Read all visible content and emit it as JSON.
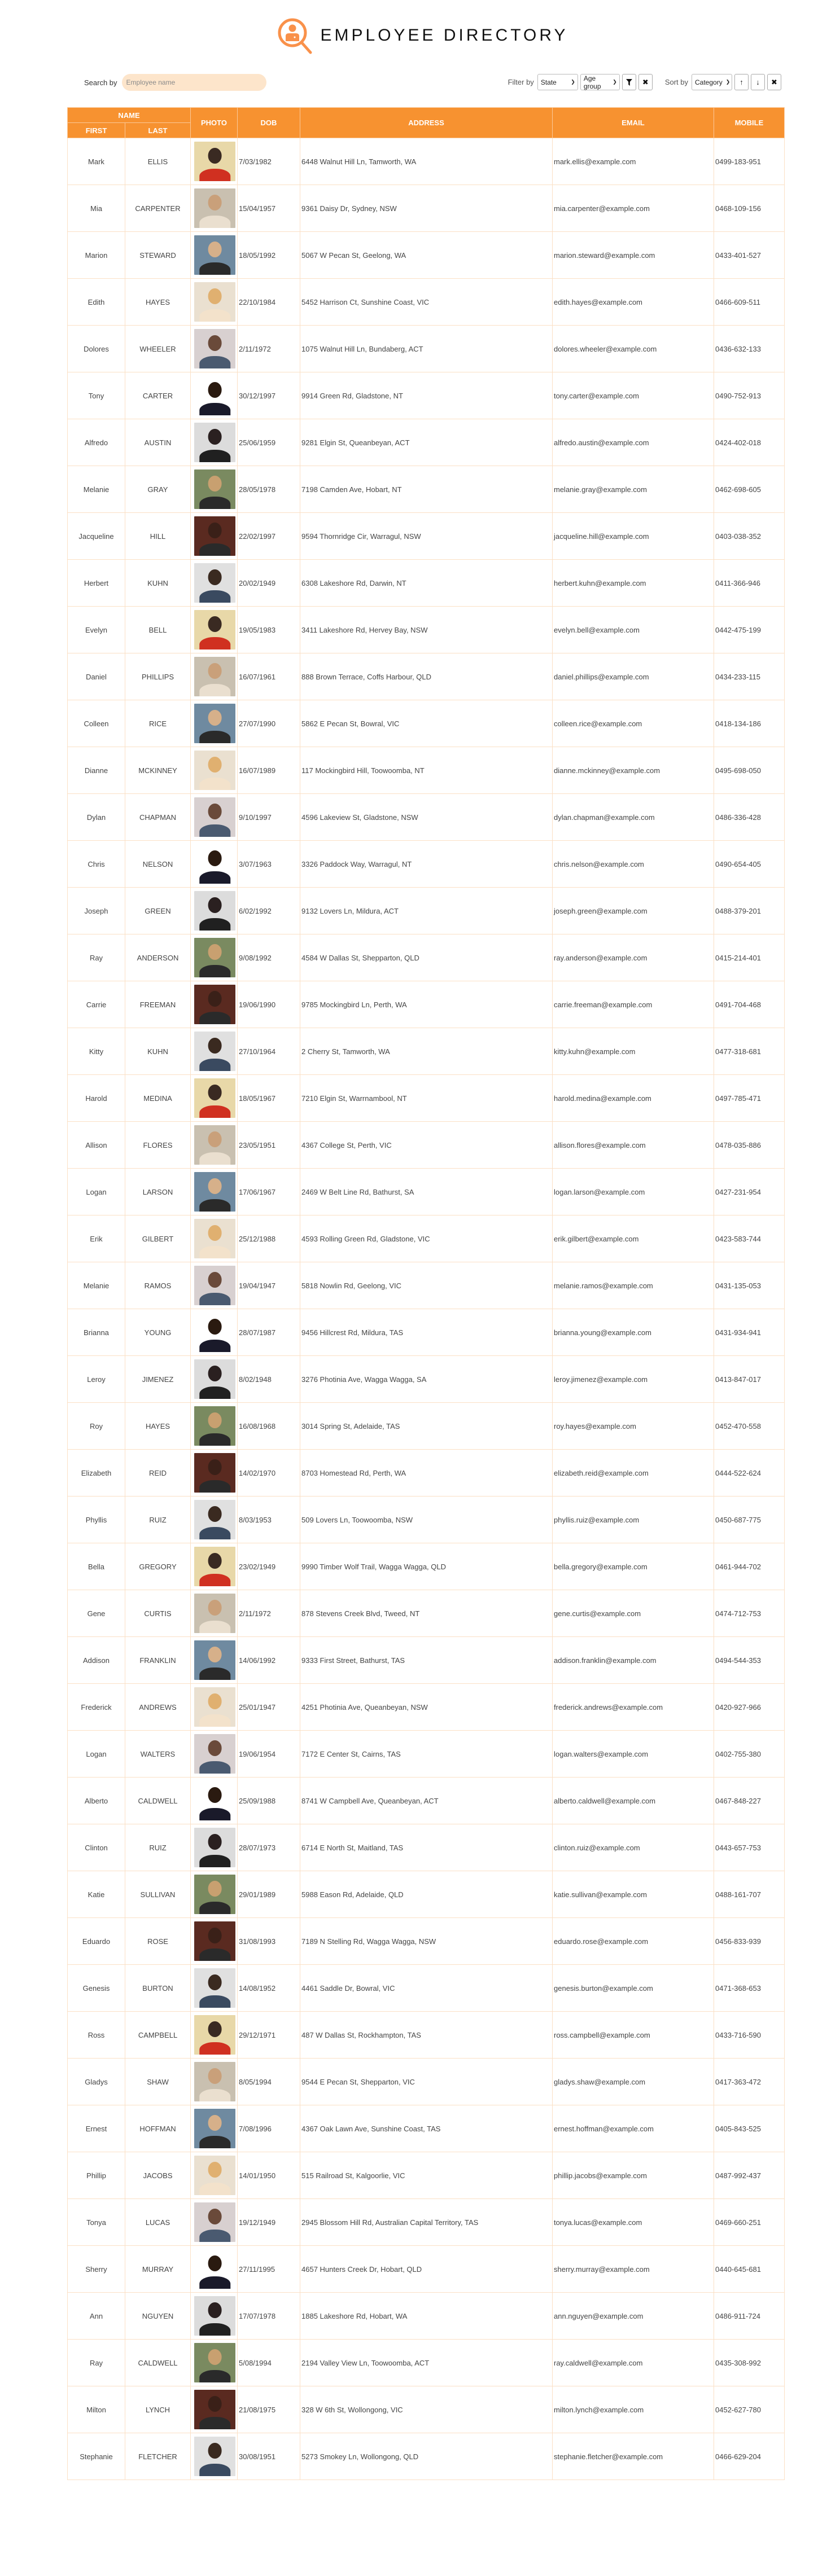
{
  "app": {
    "title": "EMPLOYEE DIRECTORY",
    "logo_icon": "magnifier-employee-icon",
    "accent_color": "#f79230",
    "accent_light": "#fde5cb"
  },
  "search": {
    "label": "Search by",
    "placeholder": "Employee name",
    "value": ""
  },
  "filter": {
    "label": "Filter by",
    "state_selected": "State",
    "age_selected": "Age group",
    "apply_icon": "funnel-icon",
    "clear_icon": "close-icon"
  },
  "sort": {
    "label": "Sort by",
    "category_selected": "Category",
    "asc_icon": "arrow-up-icon",
    "desc_icon": "arrow-down-icon",
    "clear_icon": "close-icon"
  },
  "table": {
    "headers": {
      "name": "NAME",
      "first": "FIRST",
      "last": "LAST",
      "photo": "PHOTO",
      "dob": "DOB",
      "address": "ADDRESS",
      "email": "EMAIL",
      "mobile": "MOBILE"
    },
    "rows": [
      {
        "first": "Mark",
        "last": "ELLIS",
        "dob": "7/03/1982",
        "address": "6448 Walnut Hill Ln, Tamworth, WA",
        "email": "mark.ellis@example.com",
        "mobile": "0499-183-951"
      },
      {
        "first": "Mia",
        "last": "CARPENTER",
        "dob": "15/04/1957",
        "address": "9361 Daisy Dr, Sydney, NSW",
        "email": "mia.carpenter@example.com",
        "mobile": "0468-109-156"
      },
      {
        "first": "Marion",
        "last": "STEWARD",
        "dob": "18/05/1992",
        "address": "5067 W Pecan St, Geelong, WA",
        "email": "marion.steward@example.com",
        "mobile": "0433-401-527"
      },
      {
        "first": "Edith",
        "last": "HAYES",
        "dob": "22/10/1984",
        "address": "5452 Harrison Ct, Sunshine Coast, VIC",
        "email": "edith.hayes@example.com",
        "mobile": "0466-609-511"
      },
      {
        "first": "Dolores",
        "last": "WHEELER",
        "dob": "2/11/1972",
        "address": "1075 Walnut Hill Ln, Bundaberg, ACT",
        "email": "dolores.wheeler@example.com",
        "mobile": "0436-632-133"
      },
      {
        "first": "Tony",
        "last": "CARTER",
        "dob": "30/12/1997",
        "address": "9914 Green Rd, Gladstone, NT",
        "email": "tony.carter@example.com",
        "mobile": "0490-752-913"
      },
      {
        "first": "Alfredo",
        "last": "AUSTIN",
        "dob": "25/06/1959",
        "address": "9281 Elgin St, Queanbeyan, ACT",
        "email": "alfredo.austin@example.com",
        "mobile": "0424-402-018"
      },
      {
        "first": "Melanie",
        "last": "GRAY",
        "dob": "28/05/1978",
        "address": "7198 Camden Ave, Hobart, NT",
        "email": "melanie.gray@example.com",
        "mobile": "0462-698-605"
      },
      {
        "first": "Jacqueline",
        "last": "HILL",
        "dob": "22/02/1997",
        "address": "9594 Thornridge Cir, Warragul, NSW",
        "email": "jacqueline.hill@example.com",
        "mobile": "0403-038-352"
      },
      {
        "first": "Herbert",
        "last": "KUHN",
        "dob": "20/02/1949",
        "address": "6308 Lakeshore Rd, Darwin, NT",
        "email": "herbert.kuhn@example.com",
        "mobile": "0411-366-946"
      },
      {
        "first": "Evelyn",
        "last": "BELL",
        "dob": "19/05/1983",
        "address": "3411 Lakeshore Rd, Hervey Bay, NSW",
        "email": "evelyn.bell@example.com",
        "mobile": "0442-475-199"
      },
      {
        "first": "Daniel",
        "last": "PHILLIPS",
        "dob": "16/07/1961",
        "address": "888 Brown Terrace, Coffs Harbour, QLD",
        "email": "daniel.phillips@example.com",
        "mobile": "0434-233-115"
      },
      {
        "first": "Colleen",
        "last": "RICE",
        "dob": "27/07/1990",
        "address": "5862 E Pecan St, Bowral, VIC",
        "email": "colleen.rice@example.com",
        "mobile": "0418-134-186"
      },
      {
        "first": "Dianne",
        "last": "MCKINNEY",
        "dob": "16/07/1989",
        "address": "117 Mockingbird Hill, Toowoomba, NT",
        "email": "dianne.mckinney@example.com",
        "mobile": "0495-698-050"
      },
      {
        "first": "Dylan",
        "last": "CHAPMAN",
        "dob": "9/10/1997",
        "address": "4596 Lakeview St, Gladstone, NSW",
        "email": "dylan.chapman@example.com",
        "mobile": "0486-336-428"
      },
      {
        "first": "Chris",
        "last": "NELSON",
        "dob": "3/07/1963",
        "address": "3326 Paddock Way, Warragul, NT",
        "email": "chris.nelson@example.com",
        "mobile": "0490-654-405"
      },
      {
        "first": "Joseph",
        "last": "GREEN",
        "dob": "6/02/1992",
        "address": "9132 Lovers Ln, Mildura, ACT",
        "email": "joseph.green@example.com",
        "mobile": "0488-379-201"
      },
      {
        "first": "Ray",
        "last": "ANDERSON",
        "dob": "9/08/1992",
        "address": "4584 W Dallas St, Shepparton, QLD",
        "email": "ray.anderson@example.com",
        "mobile": "0415-214-401"
      },
      {
        "first": "Carrie",
        "last": "FREEMAN",
        "dob": "19/06/1990",
        "address": "9785 Mockingbird Ln, Perth, WA",
        "email": "carrie.freeman@example.com",
        "mobile": "0491-704-468"
      },
      {
        "first": "Kitty",
        "last": "KUHN",
        "dob": "27/10/1964",
        "address": "2 Cherry St, Tamworth, WA",
        "email": "kitty.kuhn@example.com",
        "mobile": "0477-318-681"
      },
      {
        "first": "Harold",
        "last": "MEDINA",
        "dob": "18/05/1967",
        "address": "7210 Elgin St, Warrnambool, NT",
        "email": "harold.medina@example.com",
        "mobile": "0497-785-471"
      },
      {
        "first": "Allison",
        "last": "FLORES",
        "dob": "23/05/1951",
        "address": "4367 College St, Perth, VIC",
        "email": "allison.flores@example.com",
        "mobile": "0478-035-886"
      },
      {
        "first": "Logan",
        "last": "LARSON",
        "dob": "17/06/1967",
        "address": "2469 W Belt Line Rd, Bathurst, SA",
        "email": "logan.larson@example.com",
        "mobile": "0427-231-954"
      },
      {
        "first": "Erik",
        "last": "GILBERT",
        "dob": "25/12/1988",
        "address": "4593 Rolling Green Rd, Gladstone, VIC",
        "email": "erik.gilbert@example.com",
        "mobile": "0423-583-744"
      },
      {
        "first": "Melanie",
        "last": "RAMOS",
        "dob": "19/04/1947",
        "address": "5818 Nowlin Rd, Geelong, VIC",
        "email": "melanie.ramos@example.com",
        "mobile": "0431-135-053"
      },
      {
        "first": "Brianna",
        "last": "YOUNG",
        "dob": "28/07/1987",
        "address": "9456 Hillcrest Rd, Mildura, TAS",
        "email": "brianna.young@example.com",
        "mobile": "0431-934-941"
      },
      {
        "first": "Leroy",
        "last": "JIMENEZ",
        "dob": "8/02/1948",
        "address": "3276 Photinia Ave, Wagga Wagga, SA",
        "email": "leroy.jimenez@example.com",
        "mobile": "0413-847-017"
      },
      {
        "first": "Roy",
        "last": "HAYES",
        "dob": "16/08/1968",
        "address": "3014 Spring St, Adelaide, TAS",
        "email": "roy.hayes@example.com",
        "mobile": "0452-470-558"
      },
      {
        "first": "Elizabeth",
        "last": "REID",
        "dob": "14/02/1970",
        "address": "8703 Homestead Rd, Perth, WA",
        "email": "elizabeth.reid@example.com",
        "mobile": "0444-522-624"
      },
      {
        "first": "Phyllis",
        "last": "RUIZ",
        "dob": "8/03/1953",
        "address": "509 Lovers Ln, Toowoomba, NSW",
        "email": "phyllis.ruiz@example.com",
        "mobile": "0450-687-775"
      },
      {
        "first": "Bella",
        "last": "GREGORY",
        "dob": "23/02/1949",
        "address": "9990 Timber Wolf Trail, Wagga Wagga, QLD",
        "email": "bella.gregory@example.com",
        "mobile": "0461-944-702"
      },
      {
        "first": "Gene",
        "last": "CURTIS",
        "dob": "2/11/1972",
        "address": "878 Stevens Creek Blvd, Tweed, NT",
        "email": "gene.curtis@example.com",
        "mobile": "0474-712-753"
      },
      {
        "first": "Addison",
        "last": "FRANKLIN",
        "dob": "14/06/1992",
        "address": "9333 First Street, Bathurst, TAS",
        "email": "addison.franklin@example.com",
        "mobile": "0494-544-353"
      },
      {
        "first": "Frederick",
        "last": "ANDREWS",
        "dob": "25/01/1947",
        "address": "4251 Photinia Ave, Queanbeyan, NSW",
        "email": "frederick.andrews@example.com",
        "mobile": "0420-927-966"
      },
      {
        "first": "Logan",
        "last": "WALTERS",
        "dob": "19/06/1954",
        "address": "7172 E Center St, Cairns, TAS",
        "email": "logan.walters@example.com",
        "mobile": "0402-755-380"
      },
      {
        "first": "Alberto",
        "last": "CALDWELL",
        "dob": "25/09/1988",
        "address": "8741 W Campbell Ave, Queanbeyan, ACT",
        "email": "alberto.caldwell@example.com",
        "mobile": "0467-848-227"
      },
      {
        "first": "Clinton",
        "last": "RUIZ",
        "dob": "28/07/1973",
        "address": "6714 E North St, Maitland, TAS",
        "email": "clinton.ruiz@example.com",
        "mobile": "0443-657-753"
      },
      {
        "first": "Katie",
        "last": "SULLIVAN",
        "dob": "29/01/1989",
        "address": "5988 Eason Rd, Adelaide, QLD",
        "email": "katie.sullivan@example.com",
        "mobile": "0488-161-707"
      },
      {
        "first": "Eduardo",
        "last": "ROSE",
        "dob": "31/08/1993",
        "address": "7189 N Stelling Rd, Wagga Wagga, NSW",
        "email": "eduardo.rose@example.com",
        "mobile": "0456-833-939"
      },
      {
        "first": "Genesis",
        "last": "BURTON",
        "dob": "14/08/1952",
        "address": "4461 Saddle Dr, Bowral, VIC",
        "email": "genesis.burton@example.com",
        "mobile": "0471-368-653"
      },
      {
        "first": "Ross",
        "last": "CAMPBELL",
        "dob": "29/12/1971",
        "address": "487 W Dallas St, Rockhampton, TAS",
        "email": "ross.campbell@example.com",
        "mobile": "0433-716-590"
      },
      {
        "first": "Gladys",
        "last": "SHAW",
        "dob": "8/05/1994",
        "address": "9544 E Pecan St, Shepparton, VIC",
        "email": "gladys.shaw@example.com",
        "mobile": "0417-363-472"
      },
      {
        "first": "Ernest",
        "last": "HOFFMAN",
        "dob": "7/08/1996",
        "address": "4367 Oak Lawn Ave, Sunshine Coast, TAS",
        "email": "ernest.hoffman@example.com",
        "mobile": "0405-843-525"
      },
      {
        "first": "Phillip",
        "last": "JACOBS",
        "dob": "14/01/1950",
        "address": "515 Railroad St, Kalgoorlie, VIC",
        "email": "phillip.jacobs@example.com",
        "mobile": "0487-992-437"
      },
      {
        "first": "Tonya",
        "last": "LUCAS",
        "dob": "19/12/1949",
        "address": "2945 Blossom Hill Rd, Australian Capital Territory, TAS",
        "email": "tonya.lucas@example.com",
        "mobile": "0469-660-251"
      },
      {
        "first": "Sherry",
        "last": "MURRAY",
        "dob": "27/11/1995",
        "address": "4657 Hunters Creek Dr, Hobart, QLD",
        "email": "sherry.murray@example.com",
        "mobile": "0440-645-681"
      },
      {
        "first": "Ann",
        "last": "NGUYEN",
        "dob": "17/07/1978",
        "address": "1885 Lakeshore Rd, Hobart, WA",
        "email": "ann.nguyen@example.com",
        "mobile": "0486-911-724"
      },
      {
        "first": "Ray",
        "last": "CALDWELL",
        "dob": "5/08/1994",
        "address": "2194 Valley View Ln, Toowoomba, ACT",
        "email": "ray.caldwell@example.com",
        "mobile": "0435-308-992"
      },
      {
        "first": "Milton",
        "last": "LYNCH",
        "dob": "21/08/1975",
        "address": "328 W 6th St, Wollongong, VIC",
        "email": "milton.lynch@example.com",
        "mobile": "0452-627-780"
      },
      {
        "first": "Stephanie",
        "last": "FLETCHER",
        "dob": "30/08/1951",
        "address": "5273 Smokey Ln, Wollongong, QLD",
        "email": "stephanie.fletcher@example.com",
        "mobile": "0466-629-204"
      }
    ]
  }
}
